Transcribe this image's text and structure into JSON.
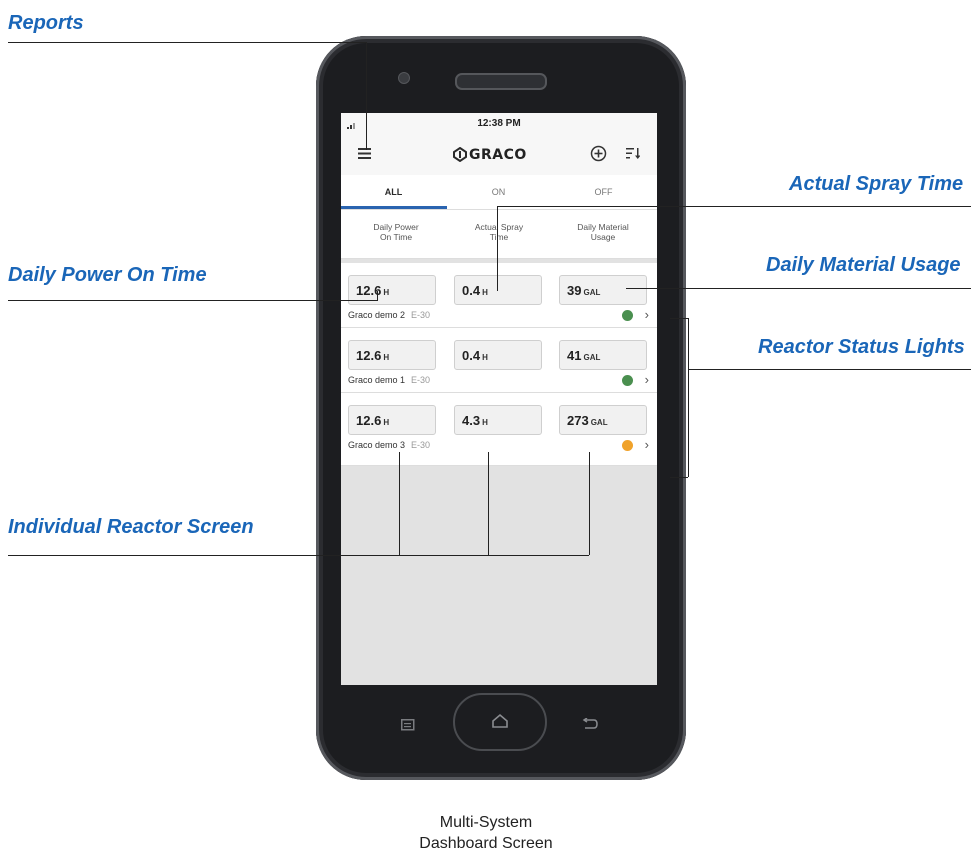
{
  "callouts": {
    "reports": "Reports",
    "actual_spray_time": "Actual Spray Time",
    "daily_power_on_time": "Daily Power On Time",
    "daily_material_usage": "Daily Material Usage",
    "reactor_status_lights": "Reactor Status Lights",
    "individual_reactor_screen": "Individual Reactor Screen"
  },
  "statusbar": {
    "time": "12:38 PM"
  },
  "appbar": {
    "brand": "GRACO",
    "menu_icon": "hamburger-icon",
    "add_icon": "plus-circle-icon",
    "sort_icon": "sort-icon"
  },
  "tabs": [
    {
      "label": "ALL",
      "active": true
    },
    {
      "label": "ON",
      "active": false
    },
    {
      "label": "OFF",
      "active": false
    }
  ],
  "columns": {
    "power_line1": "Daily Power",
    "power_line2": "On Time",
    "spray_line1": "Actual Spray",
    "spray_line2": "Time",
    "material_line1": "Daily Material",
    "material_line2": "Usage"
  },
  "reactors": [
    {
      "name": "Graco demo  2",
      "model": "E-30",
      "power": "12.6",
      "power_unit": "H",
      "spray": "0.4",
      "spray_unit": "H",
      "material": "39",
      "material_unit": "GAL",
      "status_color": "#4a8f4f"
    },
    {
      "name": "Graco demo 1",
      "model": "E-30",
      "power": "12.6",
      "power_unit": "H",
      "spray": "0.4",
      "spray_unit": "H",
      "material": "41",
      "material_unit": "GAL",
      "status_color": "#4a8f4f"
    },
    {
      "name": "Graco demo 3",
      "model": "E-30",
      "power": "12.6",
      "power_unit": "H",
      "spray": "4.3",
      "spray_unit": "H",
      "material": "273",
      "material_unit": "GAL",
      "status_color": "#f0a22a"
    }
  ],
  "caption": {
    "line1": "Multi-System",
    "line2": "Dashboard Screen"
  },
  "colors": {
    "callout": "#1a66b8",
    "tab_active": "#2a64b0"
  }
}
